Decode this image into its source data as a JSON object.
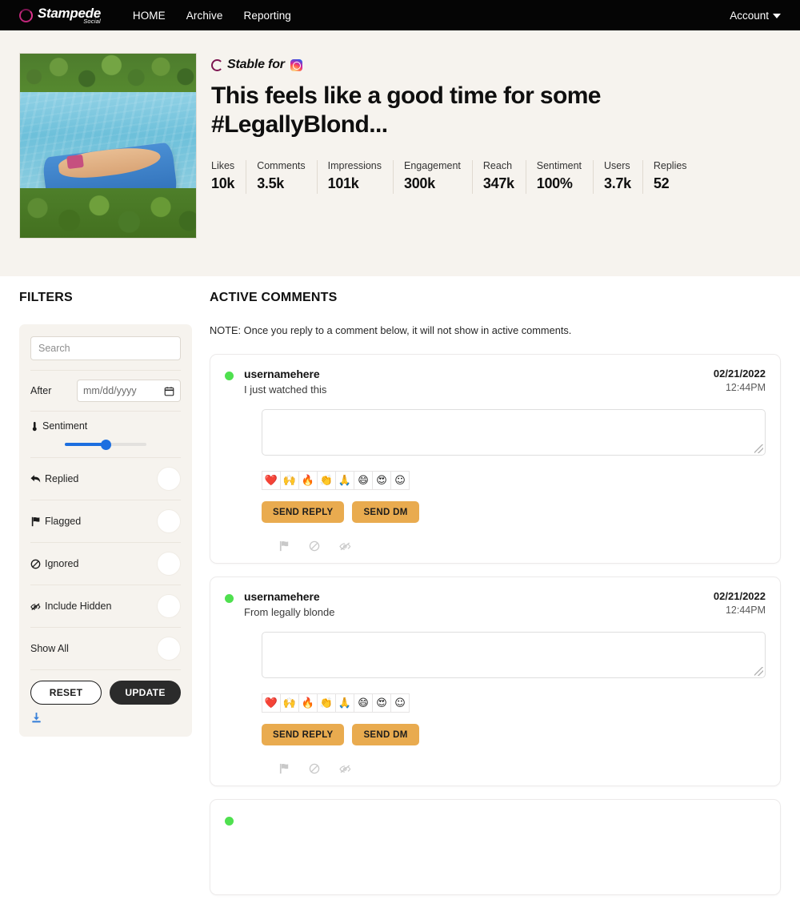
{
  "nav": {
    "brand_name": "Stampede",
    "brand_sub": "Social",
    "brand_icon": "stampede-circle-icon",
    "links": [
      {
        "label": "HOME"
      },
      {
        "label": "Archive"
      },
      {
        "label": "Reporting"
      }
    ],
    "account_label": "Account",
    "account_caret_icon": "chevron-down-icon"
  },
  "hero": {
    "image_alt": "woman floating on blue pool float",
    "platform_prefix": "Stable for",
    "platform_icon": "instagram-icon",
    "title": "This feels like a good time for some #LegallyBlond...",
    "metrics": [
      {
        "label": "Likes",
        "value": "10k"
      },
      {
        "label": "Comments",
        "value": "3.5k"
      },
      {
        "label": "Impressions",
        "value": "101k"
      },
      {
        "label": "Engagement",
        "value": "300k"
      },
      {
        "label": "Reach",
        "value": "347k"
      },
      {
        "label": "Sentiment",
        "value": "100%"
      },
      {
        "label": "Users",
        "value": "3.7k"
      },
      {
        "label": "Replies",
        "value": "52"
      }
    ]
  },
  "filters": {
    "title": "FILTERS",
    "search_placeholder": "Search",
    "search_value": "",
    "after_label": "After",
    "date_value": "mm/dd/yyyy",
    "date_icon": "calendar-icon",
    "sentiment_label": "Sentiment",
    "sentiment_icon": "thermometer-icon",
    "sentiment_slider_value": 50,
    "toggles": [
      {
        "label": "Replied",
        "icon": "reply-arrow-icon",
        "on": false
      },
      {
        "label": "Flagged",
        "icon": "flag-icon",
        "on": false
      },
      {
        "label": "Ignored",
        "icon": "ban-icon",
        "on": false
      },
      {
        "label": "Include Hidden",
        "icon": "eye-slash-icon",
        "on": false
      },
      {
        "label": "Show All",
        "icon": "",
        "on": false
      }
    ],
    "reset_label": "RESET",
    "update_label": "UPDATE",
    "download_icon": "download-icon"
  },
  "comments_section": {
    "title": "ACTIVE COMMENTS",
    "note": "NOTE: Once you reply to a comment below, it will not show in active comments.",
    "emoji_buttons": [
      "❤️",
      "🙌",
      "🔥",
      "👏",
      "🙏",
      "😄",
      "😍",
      "☺"
    ],
    "emoji_names": [
      "heart-emoji",
      "raised-hands-emoji",
      "fire-emoji",
      "clap-emoji",
      "pray-emoji",
      "grin-emoji",
      "heart-eyes-emoji",
      "emoji-picker-icon"
    ],
    "send_reply_label": "SEND REPLY",
    "send_dm_label": "SEND DM",
    "action_icons": [
      "flag-icon",
      "ban-icon",
      "eye-slash-icon"
    ],
    "reply_placeholder": "",
    "comments": [
      {
        "status": "active",
        "username": "usernamehere",
        "text": "I just watched this",
        "date": "02/21/2022",
        "time": "12:44PM",
        "reply_value": ""
      },
      {
        "status": "active",
        "username": "usernamehere",
        "text": "From legally blonde",
        "date": "02/21/2022",
        "time": "12:44PM",
        "reply_value": ""
      },
      {
        "status": "active",
        "username": "",
        "text": "",
        "date": "",
        "time": "",
        "reply_value": ""
      }
    ]
  },
  "colors": {
    "nav_bg": "#050505",
    "hero_bg": "#f6f3ee",
    "accent_orange": "#e9ab4f",
    "accent_blue": "#1d6fe0",
    "brand_pink": "#c0267a",
    "status_green": "#4fe04f",
    "dark_button": "#2b2b2b"
  }
}
